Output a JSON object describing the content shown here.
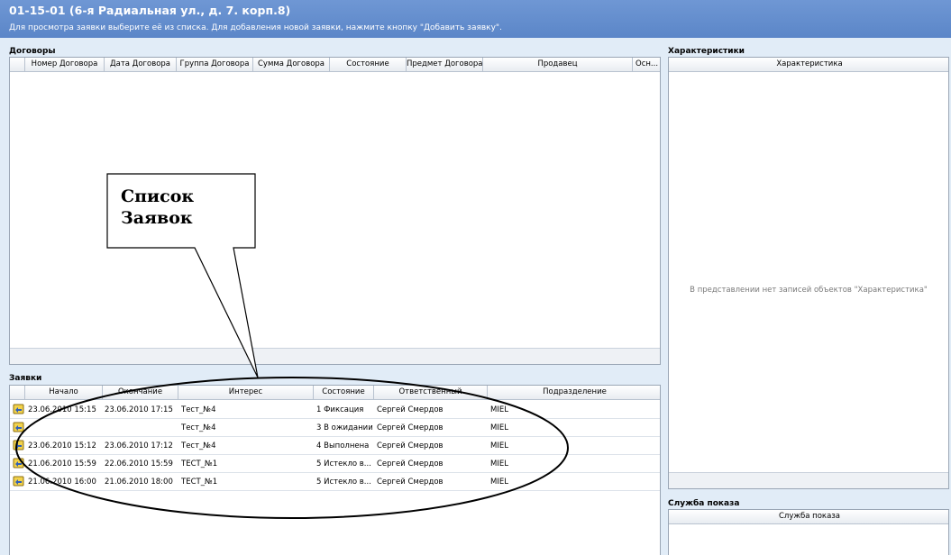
{
  "header": {
    "title": "01-15-01 (6-я Радиальная ул., д. 7. корп.8)",
    "hint": "Для просмотра заявки выберите её из списка. Для добавления новой заявки, нажмите кнопку \"Добавить заявку\"."
  },
  "contracts": {
    "title": "Договоры",
    "columns": [
      "Номер Договора",
      "Дата Договора",
      "Группа Договора",
      "Сумма Договора",
      "Состояние",
      "Предмет Договора",
      "Продавец",
      "Осн..."
    ]
  },
  "characteristics": {
    "title": "Характеристики",
    "column": "Характеристика",
    "empty_message": "В представлении нет записей объектов \"Характеристика\""
  },
  "requests": {
    "title": "Заявки",
    "columns": [
      "Начало",
      "Окончание",
      "Интерес",
      "Состояние",
      "Ответственный",
      "Подразделение"
    ],
    "rows": [
      {
        "start": "23.06.2010 15:15",
        "end": "23.06.2010 17:15",
        "interest": "Тест_№4",
        "status": "1 Фиксация",
        "responsible": "Сергей Смердов",
        "department": "MIEL"
      },
      {
        "start": "",
        "end": "",
        "interest": "Тест_№4",
        "status": "3 В ожидании",
        "responsible": "Сергей Смердов",
        "department": "MIEL"
      },
      {
        "start": "23.06.2010 15:12",
        "end": "23.06.2010 17:12",
        "interest": "Тест_№4",
        "status": "4 Выполнена",
        "responsible": "Сергей Смердов",
        "department": "MIEL"
      },
      {
        "start": "21.06.2010 15:59",
        "end": "22.06.2010 15:59",
        "interest": "ТЕСТ_№1",
        "status": "5 Истекло в...",
        "responsible": "Сергей Смердов",
        "department": "MIEL"
      },
      {
        "start": "21.06.2010 16:00",
        "end": "21.06.2010 18:00",
        "interest": "ТЕСТ_№1",
        "status": "5 Истекло в...",
        "responsible": "Сергей Смердов",
        "department": "MIEL"
      }
    ]
  },
  "show_service": {
    "title": "Служба показа",
    "column": "Служба показа"
  },
  "callout": {
    "text": "Список\nЗаявок"
  }
}
